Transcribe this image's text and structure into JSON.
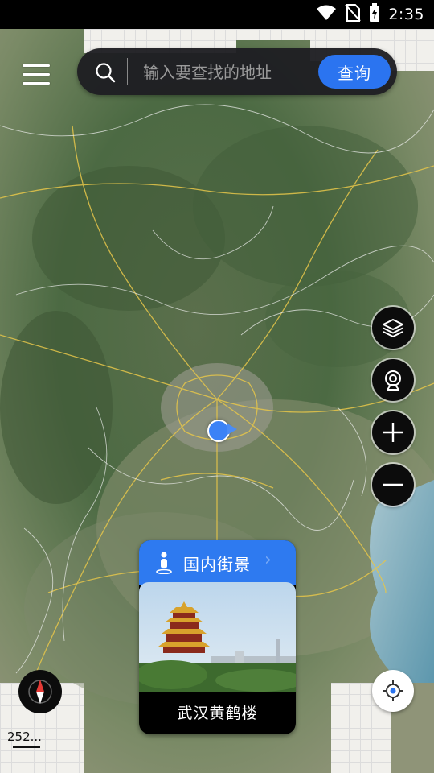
{
  "status_bar": {
    "time": "2:35",
    "icons": [
      "wifi-icon",
      "no-sim-icon",
      "battery-charging-icon"
    ]
  },
  "search": {
    "placeholder": "输入要查找的地址",
    "value": "",
    "button_label": "查询"
  },
  "map_controls": {
    "items": [
      "layers-icon",
      "street-view-camera-icon",
      "zoom-in-icon",
      "zoom-out-icon",
      "locate-icon",
      "compass-icon"
    ]
  },
  "scale": {
    "label": "252..."
  },
  "street_view_card": {
    "title": "国内街景",
    "caption": "武汉黄鹤楼"
  },
  "colors": {
    "accent": "#2b74f0",
    "search_bg": "#1e1e22",
    "control_bg": "#0c0c0c",
    "location_dot": "#3b82f6"
  }
}
